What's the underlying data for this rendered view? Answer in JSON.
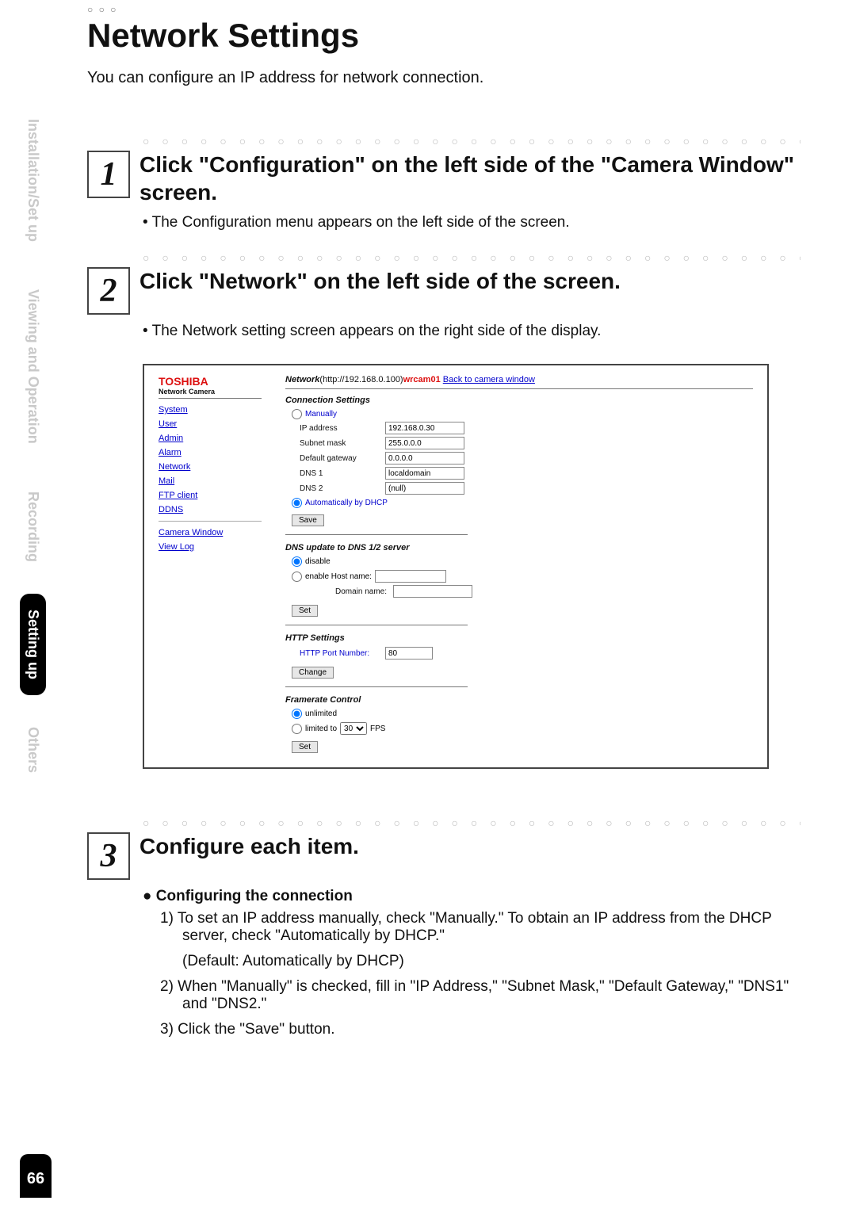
{
  "page_number": "66",
  "title_decoration": "○ ○ ○",
  "title": "Network Settings",
  "intro": "You can configure an IP address for network connection.",
  "tabs": {
    "install": "Installation/Set up",
    "viewing": "Viewing\nand Operation",
    "recording": "Recording",
    "setting": "Setting up",
    "others": "Others"
  },
  "dots": "○ ○ ○ ○ ○ ○ ○ ○ ○ ○ ○ ○ ○ ○ ○ ○ ○ ○ ○ ○ ○ ○ ○ ○ ○ ○ ○ ○ ○ ○ ○ ○ ○ ○ ○ ○ ○ ○ ○ ○ ○ ○ ○ ○",
  "step1": {
    "num": "1",
    "title": "Click \"Configuration\" on the left side of the \"Camera Window\" screen.",
    "bullet": "The Configuration menu appears on the left side of the screen."
  },
  "step2": {
    "num": "2",
    "title": "Click \"Network\" on the left side of the screen.",
    "bullet": "The Network setting screen appears on the right side of the display."
  },
  "step3": {
    "num": "3",
    "title": "Configure each item.",
    "sub": "Configuring the connection",
    "li1": "1) To set an IP address manually, check \"Manually.\" To obtain an IP address from the DHCP server, check \"Automatically by DHCP.\"",
    "li1b": "(Default: Automatically by DHCP)",
    "li2": "2) When \"Manually\" is checked, fill in \"IP Address,\" \"Subnet Mask,\" \"Default Gateway,\" \"DNS1\" and \"DNS2.\"",
    "li3": "3) Click the \"Save\" button."
  },
  "ss": {
    "brand": "TOSHIBA",
    "brand_sub": "Network Camera",
    "nav": {
      "system": "System",
      "user": "User",
      "admin": "Admin",
      "alarm": "Alarm",
      "network": "Network",
      "mail": "Mail",
      "ftp": "FTP client",
      "ddns": "DDNS",
      "camera": "Camera Window",
      "viewlog": "View Log"
    },
    "crumb_prefix": "Network",
    "crumb_url": "(http://192.168.0.100)",
    "crumb_host": "wrcam01",
    "crumb_back": "Back to camera window",
    "sec_conn": "Connection Settings",
    "radio_manual": "Manually",
    "radio_dhcp": "Automatically by DHCP",
    "lbl_ip": "IP address",
    "val_ip": "192.168.0.30",
    "lbl_mask": "Subnet mask",
    "val_mask": "255.0.0.0",
    "lbl_gw": "Default gateway",
    "val_gw": "0.0.0.0",
    "lbl_dns1": "DNS 1",
    "val_dns1": "localdomain",
    "lbl_dns2": "DNS 2",
    "val_dns2": "(null)",
    "btn_save": "Save",
    "sec_dns": "DNS update to DNS 1/2 server",
    "radio_disable": "disable",
    "radio_enable": "enable Host name:",
    "lbl_domain": "Domain name:",
    "btn_set": "Set",
    "sec_http": "HTTP Settings",
    "lbl_port": "HTTP Port Number:",
    "val_port": "80",
    "btn_change": "Change",
    "sec_fps": "Framerate Control",
    "radio_unlimited": "unlimited",
    "radio_limited_pre": "limited to",
    "radio_limited_post": "FPS",
    "fps_value": "30",
    "btn_set2": "Set"
  }
}
